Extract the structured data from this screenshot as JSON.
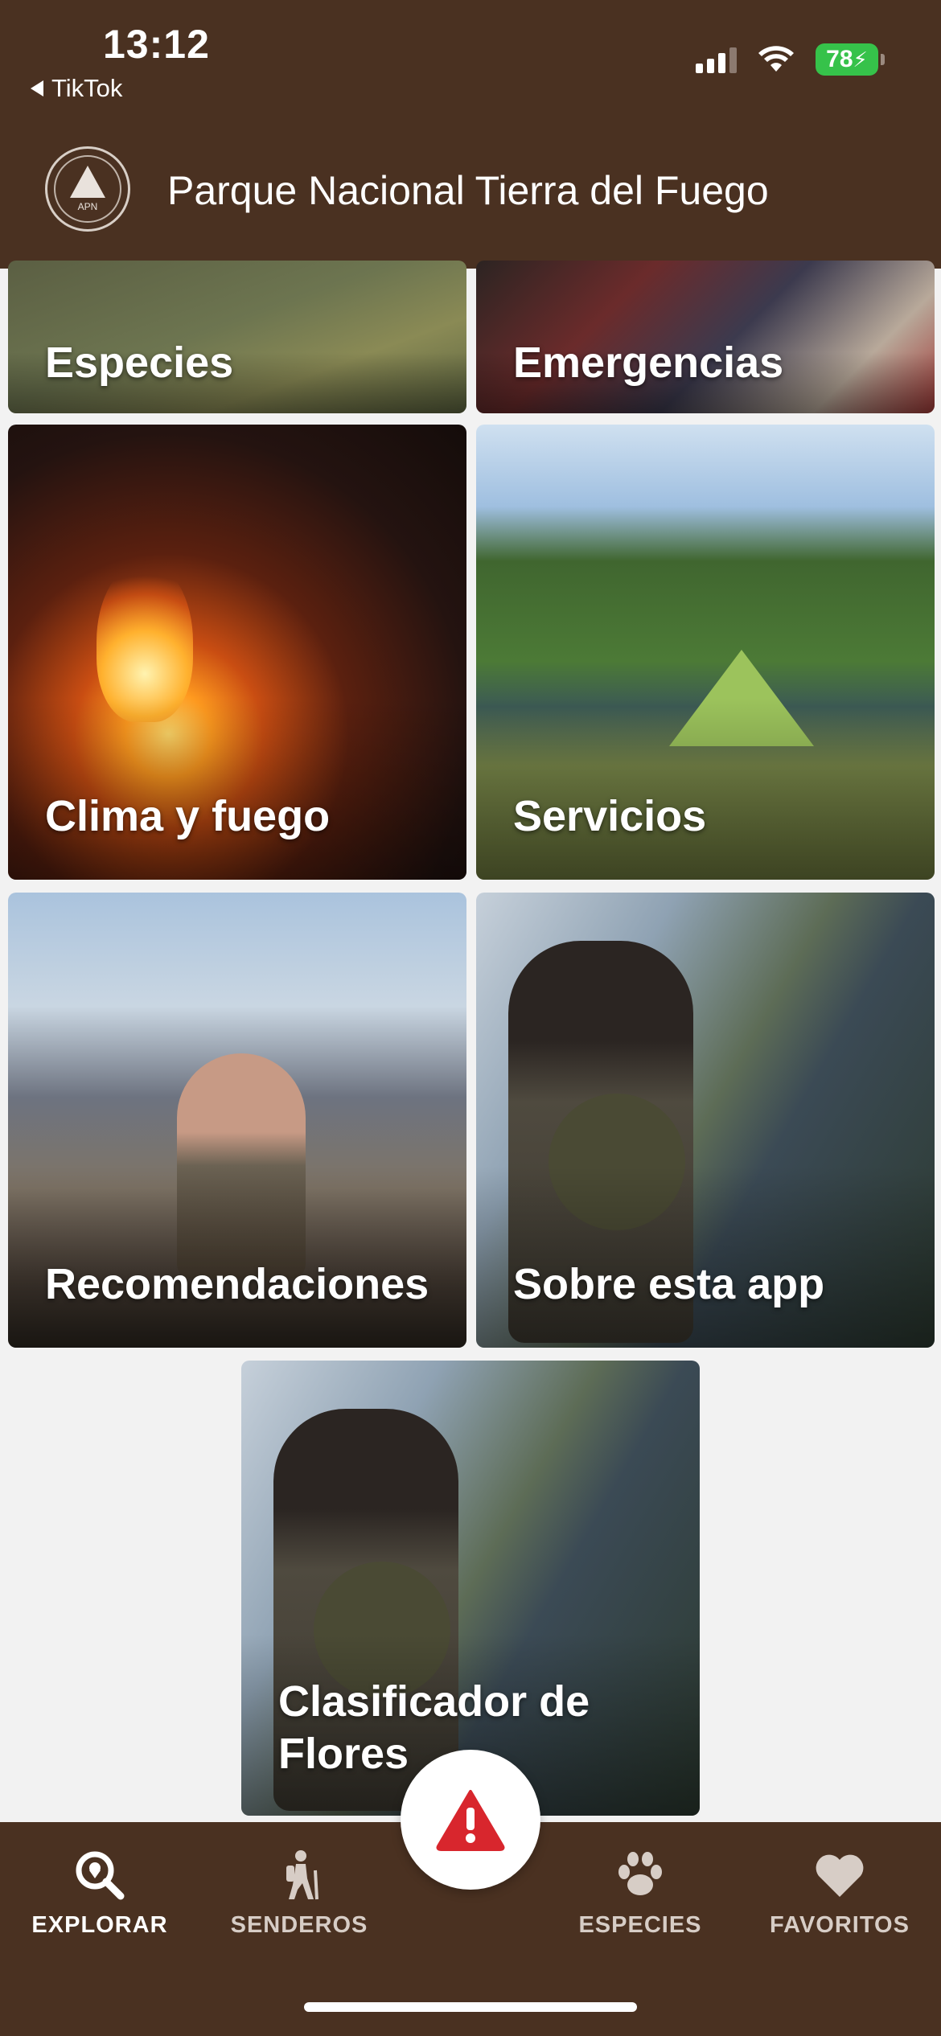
{
  "status_bar": {
    "time": "13:12",
    "back_app": "TikTok",
    "battery": "78"
  },
  "header": {
    "title": "Parque Nacional Tierra del Fuego",
    "logo_text": "APN"
  },
  "tiles": {
    "especies": "Especies",
    "emergencias": "Emergencias",
    "clima": "Clima y fuego",
    "servicios": "Servicios",
    "recomendaciones": "Recomendaciones",
    "sobre": "Sobre esta app",
    "clasificador": "Clasificador de Flores"
  },
  "bottom_nav": {
    "explorar": "EXPLORAR",
    "senderos": "SENDEROS",
    "especies": "ESPECIES",
    "favoritos": "FAVORITOS"
  },
  "colors": {
    "brand_brown": "#4a3121",
    "alert_red": "#d8262d"
  },
  "icons": {
    "fab": "warning-triangle-icon",
    "explorar": "search-location-icon",
    "senderos": "hiker-icon",
    "especies": "paw-icon",
    "favoritos": "heart-icon"
  }
}
